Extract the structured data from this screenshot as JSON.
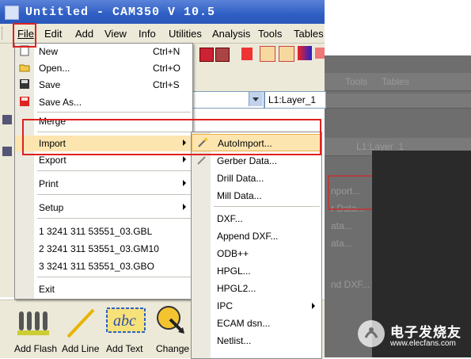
{
  "window": {
    "title": "Untitled - CAM350 V 10.5"
  },
  "menubar": [
    "File",
    "Edit",
    "Add",
    "View",
    "Info",
    "Utilities",
    "Analysis",
    "Tools",
    "Tables"
  ],
  "layer_select": {
    "value": "L1:Layer_1"
  },
  "file_menu": {
    "items": [
      {
        "label": "New",
        "shortcut": "Ctrl+N",
        "icon": "new-doc-icon"
      },
      {
        "label": "Open...",
        "shortcut": "Ctrl+O",
        "icon": "open-folder-icon"
      },
      {
        "label": "Save",
        "shortcut": "Ctrl+S",
        "icon": "save-disk-icon"
      },
      {
        "label": "Save As...",
        "shortcut": "",
        "icon": "save-as-icon"
      },
      {
        "label": "Merge",
        "shortcut": ""
      },
      {
        "label": "Import",
        "shortcut": "",
        "submenu": true
      },
      {
        "label": "Export",
        "shortcut": "",
        "submenu": true
      },
      {
        "label": "Print",
        "shortcut": "",
        "submenu": true
      },
      {
        "label": "Setup",
        "shortcut": "",
        "submenu": true
      },
      {
        "label": "1 3241 311 53551_03.GBL"
      },
      {
        "label": "2 3241 311 53551_03.GM10"
      },
      {
        "label": "3 3241 311 53551_03.GBO"
      },
      {
        "label": "Exit"
      }
    ]
  },
  "import_submenu": {
    "items": [
      {
        "label": "AutoImport...",
        "icon": "wand-icon"
      },
      {
        "label": "Gerber Data...",
        "icon": "gerber-icon"
      },
      {
        "label": "Drill Data..."
      },
      {
        "label": "Mill Data..."
      },
      {
        "label": "DXF..."
      },
      {
        "label": "Append DXF..."
      },
      {
        "label": "ODB++"
      },
      {
        "label": "HPGL..."
      },
      {
        "label": "HPGL2..."
      },
      {
        "label": "IPC",
        "submenu": true
      },
      {
        "label": "ECAM dsn..."
      },
      {
        "label": "Netlist..."
      }
    ]
  },
  "bottom_tools": [
    {
      "label": "Add Flash",
      "icon": "flash-icon"
    },
    {
      "label": "Add Line",
      "icon": "line-icon"
    },
    {
      "label": "Add Text",
      "icon": "text-abc-icon"
    },
    {
      "label": "Change Pads",
      "icon": "change-pads-icon"
    }
  ],
  "background_ghost": {
    "menus": [
      "Tools",
      "Tables"
    ],
    "layer": "L1:Layer_1",
    "items": [
      "nport...",
      "r Data...",
      "ata...",
      "ata...",
      "nd DXF..."
    ]
  },
  "watermark": {
    "name_cn": "电子发烧友",
    "url": "www.elecfans.com"
  },
  "colors": {
    "highlight": "#fde5b0",
    "red_annotation": "#e02020",
    "titlebar": "#2f5fc6"
  }
}
